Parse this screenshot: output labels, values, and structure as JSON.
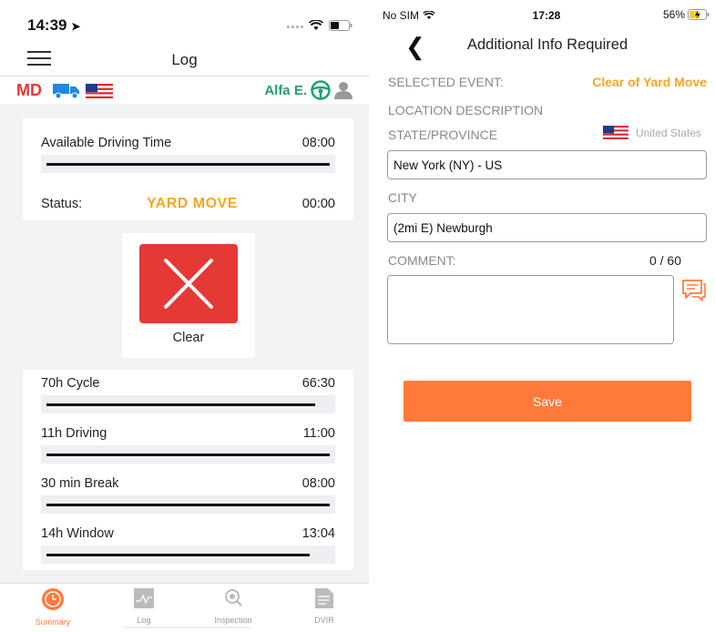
{
  "left": {
    "status_time": "14:39",
    "header_title": "Log",
    "indicator": {
      "md": "MD",
      "driver_name": "Alfa E."
    },
    "available_driving": {
      "label": "Available Driving Time",
      "value": "08:00",
      "progress": 1.0
    },
    "status": {
      "label": "Status:",
      "value": "YARD MOVE",
      "time": "00:00"
    },
    "clear_label": "Clear",
    "clocks": [
      {
        "label": "70h Cycle",
        "value": "66:30",
        "progress": 0.95
      },
      {
        "label": "11h Driving",
        "value": "11:00",
        "progress": 1.0
      },
      {
        "label": "30 min Break",
        "value": "08:00",
        "progress": 1.0
      },
      {
        "label": "14h Window",
        "value": "13:04",
        "progress": 0.93
      }
    ],
    "tabs": [
      {
        "label": "Summary",
        "icon": "clock-icon",
        "active": true
      },
      {
        "label": "Log",
        "icon": "graph-icon",
        "active": false
      },
      {
        "label": "Inspection",
        "icon": "magnifier-icon",
        "active": false
      },
      {
        "label": "DVIR",
        "icon": "document-icon",
        "active": false
      }
    ],
    "colors": {
      "accent": "#ff7a3a",
      "status": "#f5a623",
      "clear": "#e53935",
      "green": "#22a06b"
    }
  },
  "right": {
    "status": {
      "carrier": "No SIM",
      "time": "17:28",
      "battery": "56%"
    },
    "header_title": "Additional Info Required",
    "selected_event": {
      "label": "SELECTED EVENT:",
      "value": "Clear of Yard Move"
    },
    "location_label": "LOCATION DESCRIPTION",
    "state": {
      "label": "STATE/PROVINCE",
      "country": "United States",
      "value": "New York (NY) - US"
    },
    "city": {
      "label": "CITY",
      "value": "(2mi E) Newburgh"
    },
    "comment": {
      "label": "COMMENT:",
      "counter": "0 / 60",
      "value": ""
    },
    "save_label": "Save"
  }
}
